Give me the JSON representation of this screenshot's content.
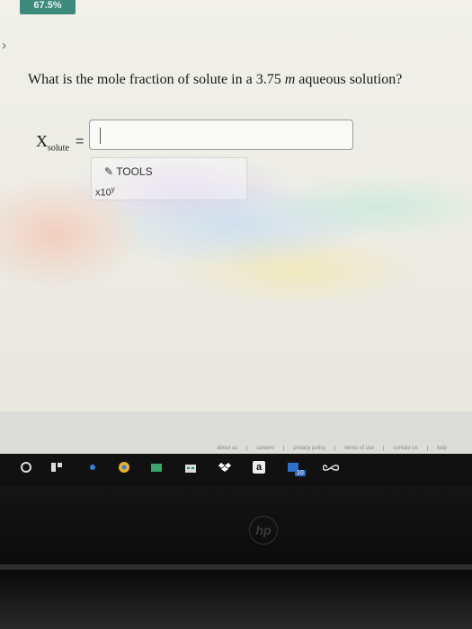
{
  "header": {
    "progress_text": "67.5%"
  },
  "question": {
    "text_before": "What is the mole fraction of solute in a 3.75 ",
    "unit": "m",
    "text_after": " aqueous solution?"
  },
  "answer": {
    "symbol": "X",
    "subscript": "solute",
    "equals": "=",
    "value": "",
    "placeholder": ""
  },
  "tools": {
    "label": "TOOLS",
    "sci_notation": "x10",
    "sci_exponent": "y"
  },
  "footer": {
    "links": [
      "about us",
      "careers",
      "privacy policy",
      "terms of use",
      "contact us",
      "help"
    ]
  },
  "taskbar": {
    "amazon_letter": "a",
    "mail_badge": "10"
  },
  "bezel": {
    "brand": "hp"
  },
  "colors": {
    "progress_tab": "#3d8a7c",
    "taskbar": "#111111"
  }
}
